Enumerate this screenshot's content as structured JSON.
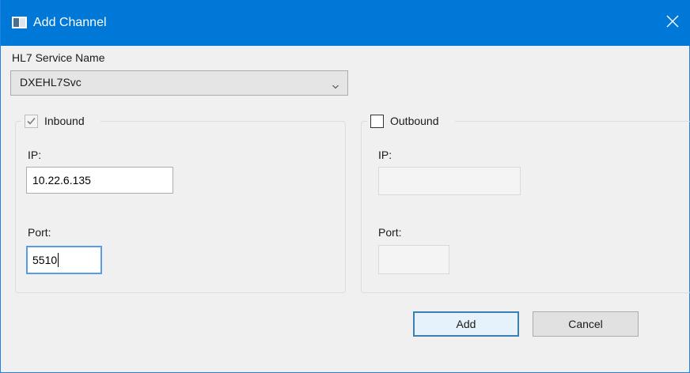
{
  "window": {
    "title": "Add Channel",
    "accent_color": "#0078d7"
  },
  "service": {
    "label": "HL7 Service Name",
    "selected_value": "DXEHL7Svc"
  },
  "inbound": {
    "label": "Inbound",
    "checked": true,
    "ip_label": "IP:",
    "ip_value": "10.22.6.135",
    "port_label": "Port:",
    "port_value": "5510"
  },
  "outbound": {
    "label": "Outbound",
    "checked": false,
    "ip_label": "IP:",
    "ip_value": "",
    "port_label": "Port:",
    "port_value": ""
  },
  "buttons": {
    "add_label": "Add",
    "cancel_label": "Cancel"
  },
  "icons": {
    "title_icon": "window-app-icon",
    "close_icon": "close-icon",
    "dropdown_icon": "chevron-down-icon",
    "check_icon": "checkmark-icon"
  }
}
